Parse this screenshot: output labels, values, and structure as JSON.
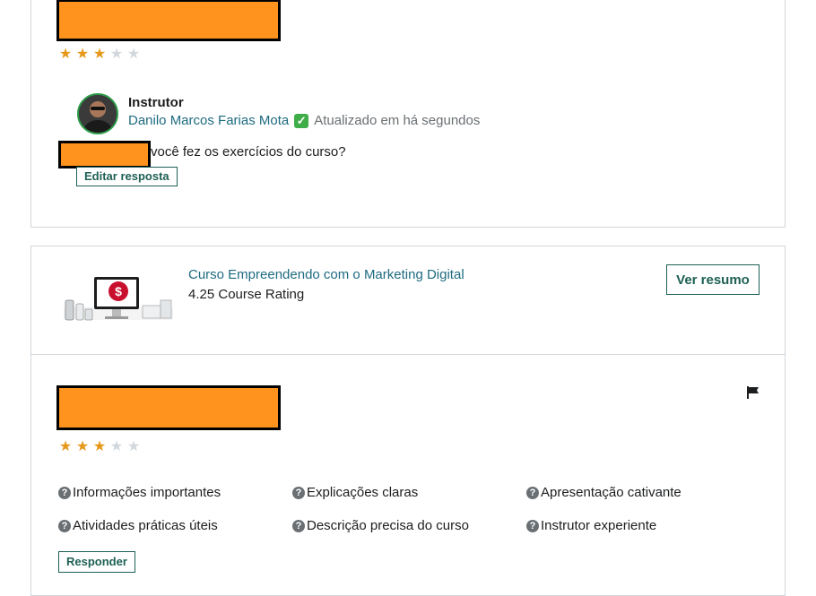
{
  "review1": {
    "rating": 3,
    "rating_max": 5,
    "instructor_label": "Instrutor",
    "instructor_name": "Danilo Marcos Farias Mota",
    "verified_icon": "check-mark-emoji",
    "updated_text": "Atualizado em há segundos",
    "response_text": "você fez os exercícios do curso?",
    "edit_button": "Editar resposta"
  },
  "course": {
    "title": "Curso Empreendendo com o Marketing Digital",
    "rating_text": "4.25 Course Rating",
    "summary_button": "Ver resumo",
    "thumbnail_icon": "dollar-sign-icon"
  },
  "review2": {
    "rating": 3,
    "rating_max": 5,
    "tags": [
      "Informações importantes",
      "Explicações claras",
      "Apresentação cativante",
      "Atividades práticas úteis",
      "Descrição precisa do curso",
      "Instrutor experiente"
    ],
    "reply_button": "Responder"
  },
  "colors": {
    "accent": "#1e6055",
    "link": "#1e6b80",
    "star": "#e59819",
    "redaction": "#ff931e"
  }
}
